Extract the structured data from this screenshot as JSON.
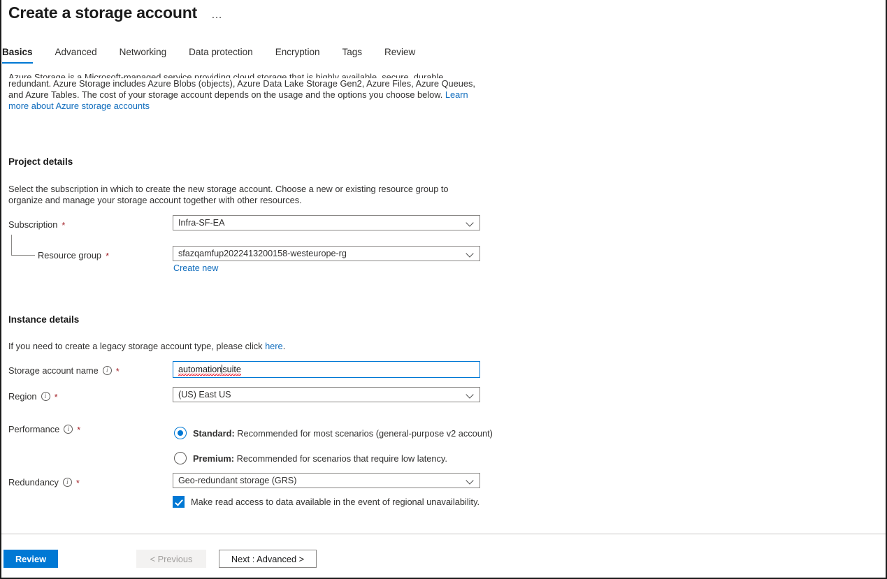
{
  "header": {
    "title": "Create a storage account",
    "more_menu": "…"
  },
  "tabs": [
    {
      "label": "Basics",
      "active": true
    },
    {
      "label": "Advanced",
      "active": false
    },
    {
      "label": "Networking",
      "active": false
    },
    {
      "label": "Data protection",
      "active": false
    },
    {
      "label": "Encryption",
      "active": false
    },
    {
      "label": "Tags",
      "active": false
    },
    {
      "label": "Review",
      "active": false
    }
  ],
  "intro": {
    "line_clipped": "Azure Storage is a Microsoft-managed service providing cloud storage that is highly available, secure, durable, scalable, and",
    "body": "redundant. Azure Storage includes Azure Blobs (objects), Azure Data Lake Storage Gen2, Azure Files, Azure Queues, and Azure Tables. The cost of your storage account depends on the usage and the options you choose below. ",
    "link": "Learn more about Azure storage accounts"
  },
  "project_details": {
    "heading": "Project details",
    "description": "Select the subscription in which to create the new storage account. Choose a new or existing resource group to organize and manage your storage account together with other resources.",
    "subscription": {
      "label": "Subscription",
      "required": "*",
      "value": "Infra-SF-EA"
    },
    "resource_group": {
      "label": "Resource group",
      "required": "*",
      "value": "sfazqamfup2022413200158-westeurope-rg",
      "create_new": "Create new"
    }
  },
  "instance_details": {
    "heading": "Instance details",
    "legacy_note_before": "If you need to create a legacy storage account type, please click ",
    "legacy_note_link": "here",
    "legacy_note_after": ".",
    "storage_account_name": {
      "label": "Storage account name",
      "required": "*",
      "info": "i",
      "value_part1": "automation",
      "value_part2": "suite",
      "value": "automationsuite"
    },
    "region": {
      "label": "Region",
      "required": "*",
      "info": "i",
      "value": "(US) East US"
    },
    "performance": {
      "label": "Performance",
      "required": "*",
      "info": "i",
      "options": [
        {
          "bold": "Standard:",
          "text": " Recommended for most scenarios (general-purpose v2 account)",
          "selected": true
        },
        {
          "bold": "Premium:",
          "text": " Recommended for scenarios that require low latency.",
          "selected": false
        }
      ]
    },
    "redundancy": {
      "label": "Redundancy",
      "required": "*",
      "info": "i",
      "value": "Geo-redundant storage (GRS)",
      "checkbox_label": "Make read access to data available in the event of regional unavailability.",
      "checkbox_checked": true
    }
  },
  "footer": {
    "review_label": "Review",
    "previous_label": "< Previous",
    "next_label": "Next : Advanced >"
  },
  "colors": {
    "accent": "#0078d4",
    "link": "#0f6cbd",
    "required": "#a4262c",
    "border": "#8a8886",
    "disabled_bg": "#f3f2f1",
    "disabled_text": "#a19f9d",
    "spellcheck": "#e81123"
  }
}
